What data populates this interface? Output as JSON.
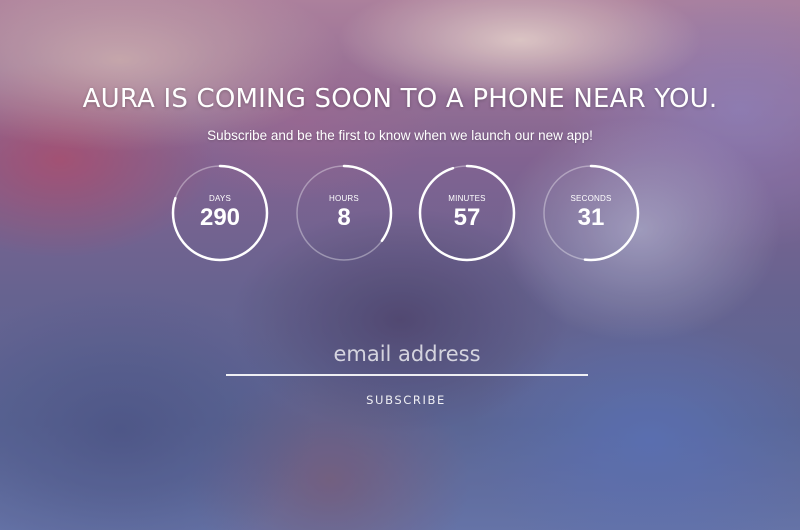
{
  "page": {
    "headline": "AURA IS COMING SOON TO A PHONE NEAR YOU.",
    "subline": "Subscribe and be the first to know when we launch our new app!"
  },
  "countdown": [
    {
      "unit": "DAYS",
      "value": "290",
      "progress": 0.8
    },
    {
      "unit": "HOURS",
      "value": "8",
      "progress": 0.35
    },
    {
      "unit": "MINUTES",
      "value": "57",
      "progress": 0.95
    },
    {
      "unit": "SECONDS",
      "value": "31",
      "progress": 0.52
    }
  ],
  "form": {
    "email_placeholder": "email address",
    "email_value": "",
    "subscribe_label": "SUBSCRIBE"
  },
  "colors": {
    "text": "#ffffff",
    "ring_track": "rgba(255,255,255,0.35)",
    "ring_progress": "#ffffff"
  }
}
